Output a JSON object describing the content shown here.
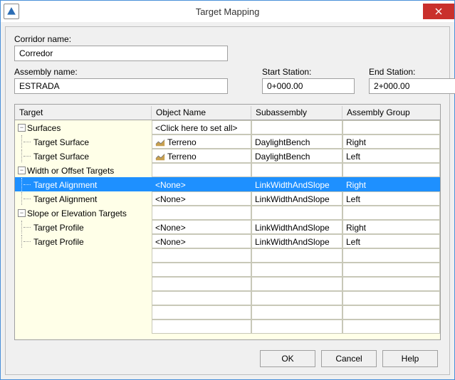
{
  "window": {
    "title": "Target Mapping"
  },
  "fields": {
    "corridor_label": "Corridor name:",
    "corridor_value": "Corredor",
    "assembly_label": "Assembly name:",
    "assembly_value": "ESTRADA",
    "start_label": "Start Station:",
    "start_value": "0+000.00",
    "end_label": "End Station:",
    "end_value": "2+000.00"
  },
  "grid": {
    "headers": {
      "target": "Target",
      "object": "Object Name",
      "sub": "Subassembly",
      "group": "Assembly Group"
    },
    "rows": {
      "surfaces_group": "Surfaces",
      "surfaces_setall": "<Click here to set all>",
      "s1_label": "Target Surface",
      "s1_obj": "Terreno",
      "s1_sub": "DaylightBench",
      "s1_grp": "Right",
      "s2_label": "Target Surface",
      "s2_obj": "Terreno",
      "s2_sub": "DaylightBench",
      "s2_grp": "Left",
      "width_group": "Width or Offset Targets",
      "w1_label": "Target Alignment",
      "w1_obj": "<None>",
      "w1_sub": "LinkWidthAndSlope",
      "w1_grp": "Right",
      "w2_label": "Target Alignment",
      "w2_obj": "<None>",
      "w2_sub": "LinkWidthAndSlope",
      "w2_grp": "Left",
      "slope_group": "Slope or Elevation Targets",
      "p1_label": "Target Profile",
      "p1_obj": "<None>",
      "p1_sub": "LinkWidthAndSlope",
      "p1_grp": "Right",
      "p2_label": "Target Profile",
      "p2_obj": "<None>",
      "p2_sub": "LinkWidthAndSlope",
      "p2_grp": "Left"
    }
  },
  "buttons": {
    "ok": "OK",
    "cancel": "Cancel",
    "help": "Help"
  }
}
